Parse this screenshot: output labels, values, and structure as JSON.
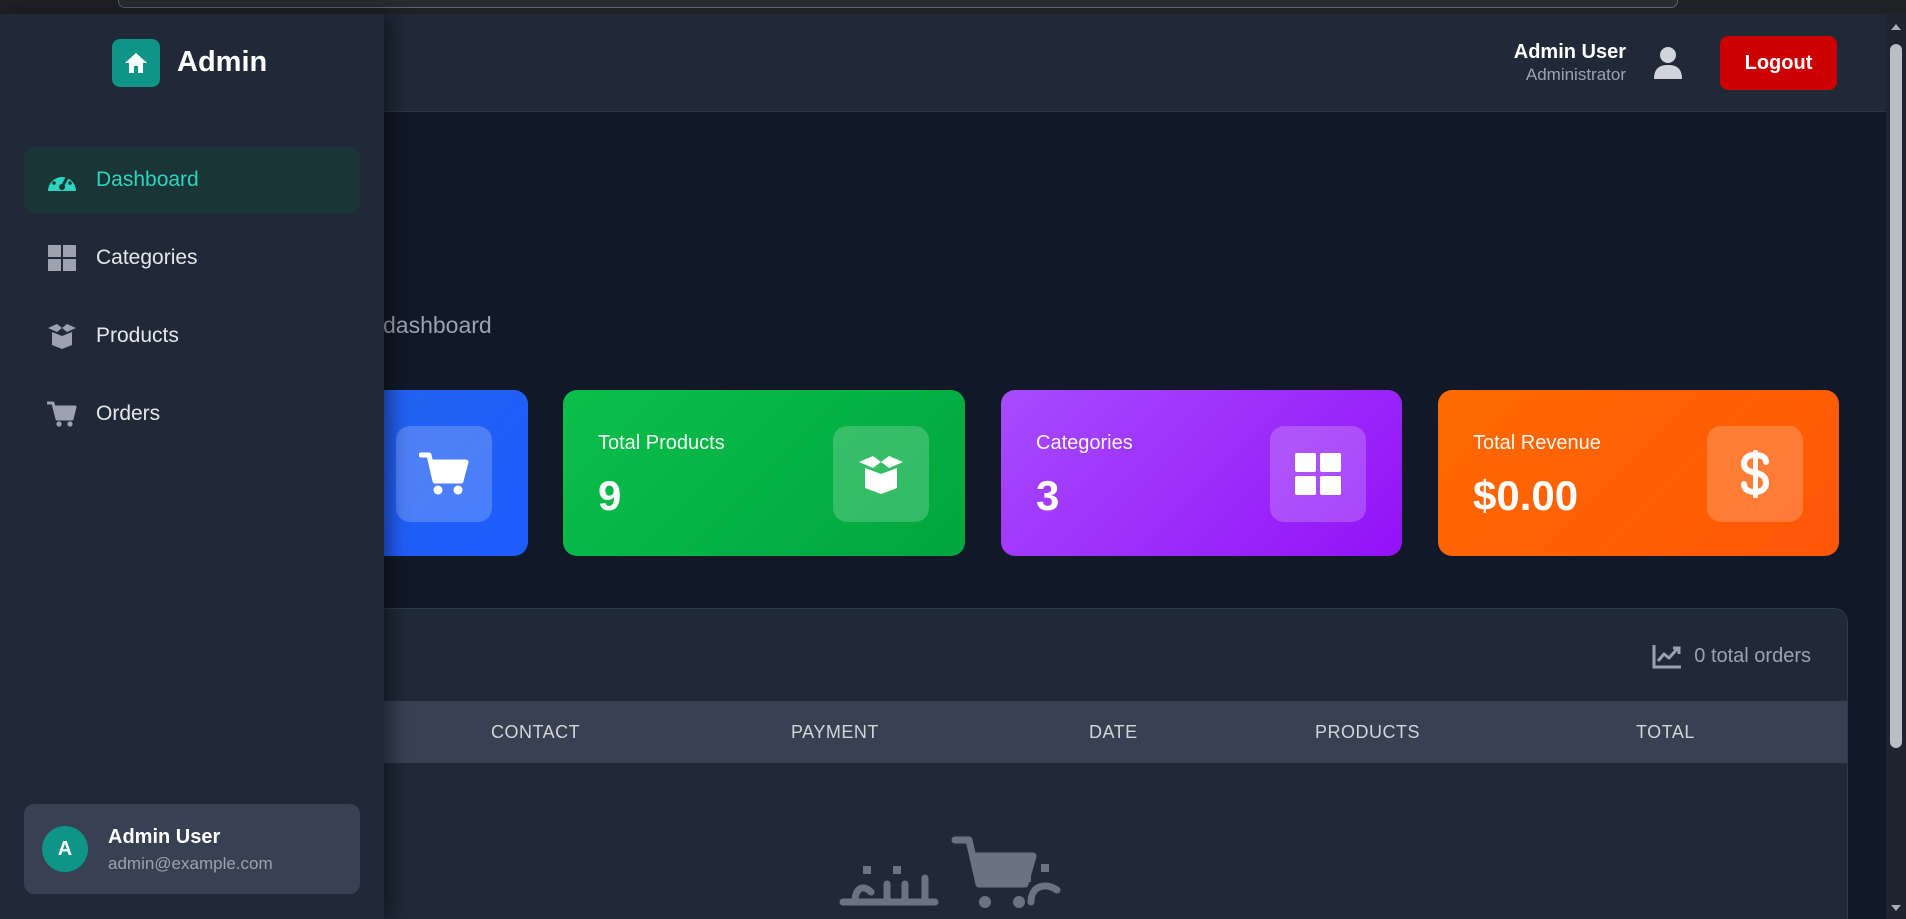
{
  "brand": {
    "name": "Admin",
    "logo_icon": "home-icon",
    "accent": "#0f9488"
  },
  "sidebar": {
    "items": [
      {
        "label": "Dashboard",
        "icon": "dashboard-gauge-icon",
        "active": true
      },
      {
        "label": "Categories",
        "icon": "grid-icon",
        "active": false
      },
      {
        "label": "Products",
        "icon": "box-icon",
        "active": false
      },
      {
        "label": "Orders",
        "icon": "cart-icon",
        "active": false
      }
    ],
    "profile": {
      "avatar_letter": "A",
      "name": "Admin User",
      "email": "admin@example.com"
    }
  },
  "header": {
    "user_name": "Admin User",
    "user_role": "Administrator",
    "user_icon": "user-icon",
    "logout_label": "Logout",
    "logout_color": "#cc0000"
  },
  "page": {
    "subtitle": "dashboard"
  },
  "stats": [
    {
      "label": "",
      "value": "",
      "icon": "cart-icon",
      "color": "#2563eb"
    },
    {
      "label": "Total Products",
      "value": "9",
      "icon": "box-icon",
      "color": "#00b345"
    },
    {
      "label": "Categories",
      "value": "3",
      "icon": "grid-icon",
      "color": "#9c2df9"
    },
    {
      "label": "Total Revenue",
      "value": "$0.00",
      "icon": "dollar-icon",
      "color": "#ff5f05"
    }
  ],
  "orders": {
    "total_text": "0 total orders",
    "meta_icon": "chart-line-icon",
    "columns": [
      "CONTACT",
      "PAYMENT",
      "DATE",
      "PRODUCTS",
      "TOTAL"
    ]
  },
  "watermark": {
    "icon": "cart-icon",
    "color": "#6b7280"
  }
}
